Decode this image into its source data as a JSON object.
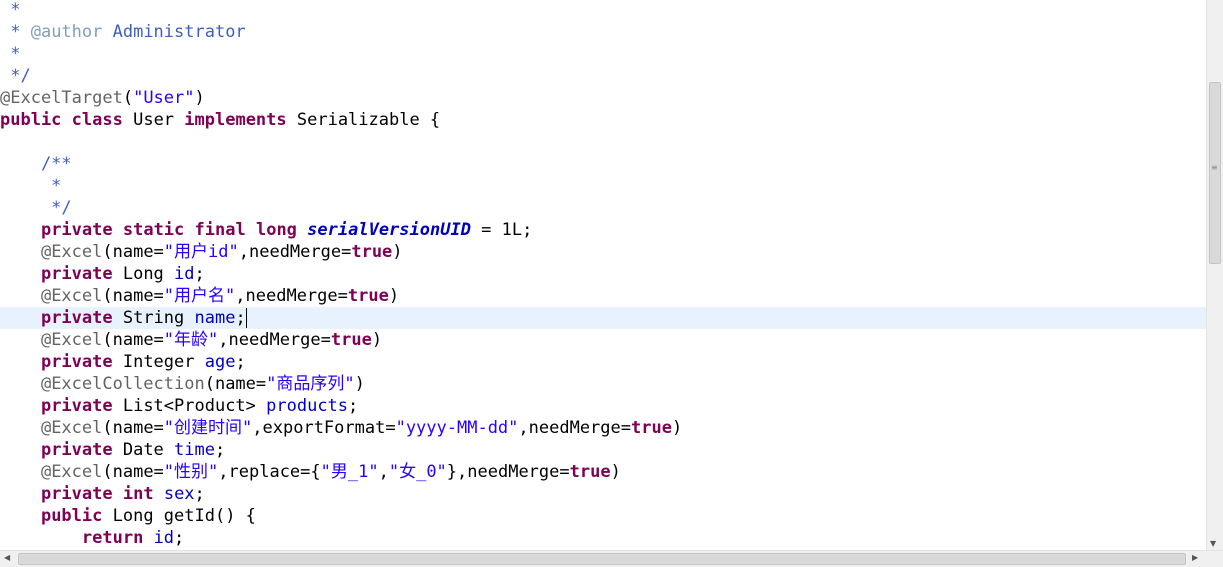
{
  "editor": {
    "current_line_index": 14,
    "caret_after_token": 3,
    "lines": [
      {
        "tokens": [
          {
            "t": " *",
            "k": "doc"
          }
        ]
      },
      {
        "tokens": [
          {
            "t": " * ",
            "k": "doc"
          },
          {
            "t": "@author",
            "k": "doctag"
          },
          {
            "t": " Administrator",
            "k": "doc"
          }
        ]
      },
      {
        "tokens": [
          {
            "t": " *",
            "k": "doc"
          }
        ]
      },
      {
        "tokens": [
          {
            "t": " */",
            "k": "doc"
          }
        ]
      },
      {
        "tokens": [
          {
            "t": "@ExcelTarget",
            "k": "ann"
          },
          {
            "t": "(",
            "k": "plain"
          },
          {
            "t": "\"User\"",
            "k": "str"
          },
          {
            "t": ")",
            "k": "plain"
          }
        ]
      },
      {
        "tokens": [
          {
            "t": "public",
            "k": "kw"
          },
          {
            "t": " ",
            "k": "plain"
          },
          {
            "t": "class",
            "k": "kw"
          },
          {
            "t": " User ",
            "k": "plain"
          },
          {
            "t": "implements",
            "k": "kw"
          },
          {
            "t": " Serializable {",
            "k": "plain"
          }
        ]
      },
      {
        "tokens": []
      },
      {
        "tokens": [
          {
            "t": "    /**",
            "k": "doc"
          }
        ]
      },
      {
        "tokens": [
          {
            "t": "     *",
            "k": "doc"
          }
        ]
      },
      {
        "tokens": [
          {
            "t": "     */",
            "k": "doc"
          }
        ]
      },
      {
        "tokens": [
          {
            "t": "    ",
            "k": "plain"
          },
          {
            "t": "private",
            "k": "kw"
          },
          {
            "t": " ",
            "k": "plain"
          },
          {
            "t": "static",
            "k": "kw"
          },
          {
            "t": " ",
            "k": "plain"
          },
          {
            "t": "final",
            "k": "kw"
          },
          {
            "t": " ",
            "k": "plain"
          },
          {
            "t": "long",
            "k": "kw"
          },
          {
            "t": " ",
            "k": "plain"
          },
          {
            "t": "serialVersionUID",
            "k": "const"
          },
          {
            "t": " = 1L;",
            "k": "plain"
          }
        ]
      },
      {
        "tokens": [
          {
            "t": "    ",
            "k": "plain"
          },
          {
            "t": "@Excel",
            "k": "ann"
          },
          {
            "t": "(name=",
            "k": "plain"
          },
          {
            "t": "\"用户id\"",
            "k": "str"
          },
          {
            "t": ",needMerge=",
            "k": "plain"
          },
          {
            "t": "true",
            "k": "kw"
          },
          {
            "t": ")",
            "k": "plain"
          }
        ]
      },
      {
        "tokens": [
          {
            "t": "    ",
            "k": "plain"
          },
          {
            "t": "private",
            "k": "kw"
          },
          {
            "t": " Long ",
            "k": "plain"
          },
          {
            "t": "id",
            "k": "field"
          },
          {
            "t": ";",
            "k": "plain"
          }
        ]
      },
      {
        "tokens": [
          {
            "t": "    ",
            "k": "plain"
          },
          {
            "t": "@Excel",
            "k": "ann"
          },
          {
            "t": "(name=",
            "k": "plain"
          },
          {
            "t": "\"用户名\"",
            "k": "str"
          },
          {
            "t": ",needMerge=",
            "k": "plain"
          },
          {
            "t": "true",
            "k": "kw"
          },
          {
            "t": ")",
            "k": "plain"
          }
        ]
      },
      {
        "tokens": [
          {
            "t": "    ",
            "k": "plain"
          },
          {
            "t": "private",
            "k": "kw"
          },
          {
            "t": " String ",
            "k": "plain"
          },
          {
            "t": "name",
            "k": "field"
          },
          {
            "t": ";",
            "k": "plain"
          }
        ]
      },
      {
        "tokens": [
          {
            "t": "    ",
            "k": "plain"
          },
          {
            "t": "@Excel",
            "k": "ann"
          },
          {
            "t": "(name=",
            "k": "plain"
          },
          {
            "t": "\"年龄\"",
            "k": "str"
          },
          {
            "t": ",needMerge=",
            "k": "plain"
          },
          {
            "t": "true",
            "k": "kw"
          },
          {
            "t": ")",
            "k": "plain"
          }
        ]
      },
      {
        "tokens": [
          {
            "t": "    ",
            "k": "plain"
          },
          {
            "t": "private",
            "k": "kw"
          },
          {
            "t": " Integer ",
            "k": "plain"
          },
          {
            "t": "age",
            "k": "field"
          },
          {
            "t": ";",
            "k": "plain"
          }
        ]
      },
      {
        "tokens": [
          {
            "t": "    ",
            "k": "plain"
          },
          {
            "t": "@ExcelCollection",
            "k": "ann"
          },
          {
            "t": "(name=",
            "k": "plain"
          },
          {
            "t": "\"商品序列\"",
            "k": "str"
          },
          {
            "t": ")",
            "k": "plain"
          }
        ]
      },
      {
        "tokens": [
          {
            "t": "    ",
            "k": "plain"
          },
          {
            "t": "private",
            "k": "kw"
          },
          {
            "t": " List<Product> ",
            "k": "plain"
          },
          {
            "t": "products",
            "k": "field"
          },
          {
            "t": ";",
            "k": "plain"
          }
        ]
      },
      {
        "tokens": [
          {
            "t": "    ",
            "k": "plain"
          },
          {
            "t": "@Excel",
            "k": "ann"
          },
          {
            "t": "(name=",
            "k": "plain"
          },
          {
            "t": "\"创建时间\"",
            "k": "str"
          },
          {
            "t": ",exportFormat=",
            "k": "plain"
          },
          {
            "t": "\"yyyy-MM-dd\"",
            "k": "str"
          },
          {
            "t": ",needMerge=",
            "k": "plain"
          },
          {
            "t": "true",
            "k": "kw"
          },
          {
            "t": ")",
            "k": "plain"
          }
        ]
      },
      {
        "tokens": [
          {
            "t": "    ",
            "k": "plain"
          },
          {
            "t": "private",
            "k": "kw"
          },
          {
            "t": " Date ",
            "k": "plain"
          },
          {
            "t": "time",
            "k": "field"
          },
          {
            "t": ";",
            "k": "plain"
          }
        ]
      },
      {
        "tokens": [
          {
            "t": "    ",
            "k": "plain"
          },
          {
            "t": "@Excel",
            "k": "ann"
          },
          {
            "t": "(name=",
            "k": "plain"
          },
          {
            "t": "\"性别\"",
            "k": "str"
          },
          {
            "t": ",replace={",
            "k": "plain"
          },
          {
            "t": "\"男_1\"",
            "k": "str"
          },
          {
            "t": ",",
            "k": "plain"
          },
          {
            "t": "\"女_0\"",
            "k": "str"
          },
          {
            "t": "},needMerge=",
            "k": "plain"
          },
          {
            "t": "true",
            "k": "kw"
          },
          {
            "t": ")",
            "k": "plain"
          }
        ]
      },
      {
        "tokens": [
          {
            "t": "    ",
            "k": "plain"
          },
          {
            "t": "private",
            "k": "kw"
          },
          {
            "t": " ",
            "k": "plain"
          },
          {
            "t": "int",
            "k": "kw"
          },
          {
            "t": " ",
            "k": "plain"
          },
          {
            "t": "sex",
            "k": "field"
          },
          {
            "t": ";",
            "k": "plain"
          }
        ]
      },
      {
        "tokens": [
          {
            "t": "    ",
            "k": "plain"
          },
          {
            "t": "public",
            "k": "kw"
          },
          {
            "t": " Long getId() {",
            "k": "plain"
          }
        ]
      },
      {
        "tokens": [
          {
            "t": "        ",
            "k": "plain"
          },
          {
            "t": "return",
            "k": "kw"
          },
          {
            "t": " ",
            "k": "plain"
          },
          {
            "t": "id",
            "k": "field"
          },
          {
            "t": ";",
            "k": "plain"
          }
        ]
      }
    ]
  },
  "colors": {
    "doc": "#3f5fbf",
    "doctag": "#7f9fbf",
    "ann": "#646464",
    "kw": "#7f0055",
    "str": "#2a00ff",
    "field": "#0000c0",
    "const": "#0000c0",
    "plain": "#000000",
    "current_line": "#e8f2fe"
  },
  "scrollbar": {
    "vertical_icon": "grip-icon",
    "down_icon": "arrow-down-icon",
    "left_icon": "arrow-left-icon",
    "right_icon": "arrow-right-icon"
  }
}
